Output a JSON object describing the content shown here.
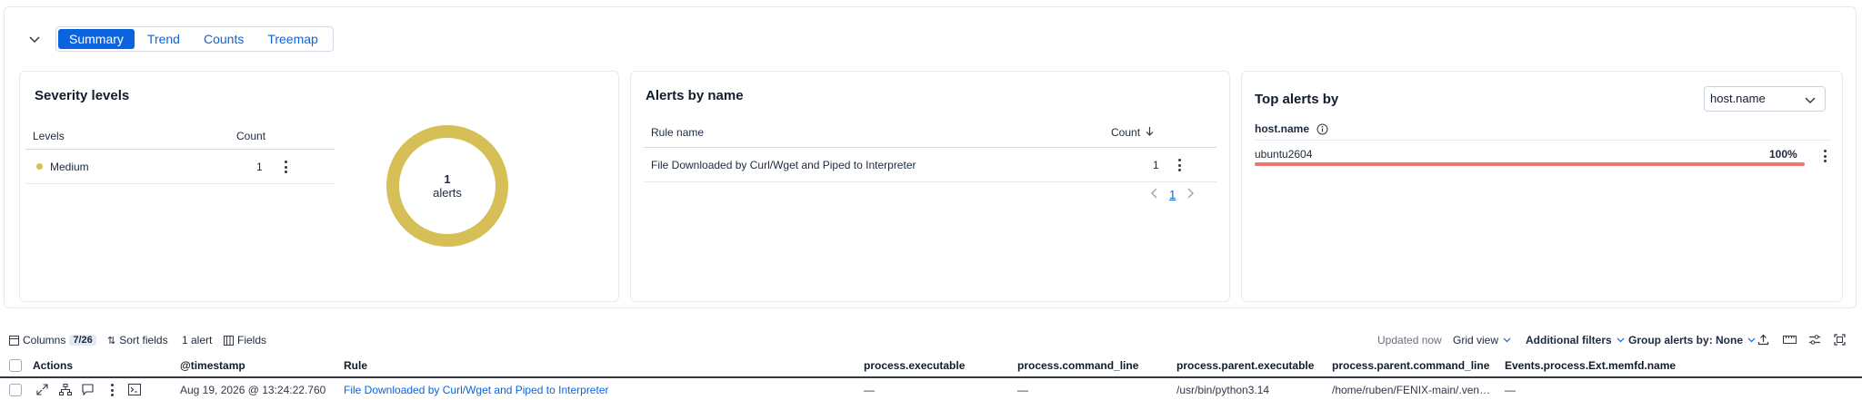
{
  "tabs": [
    "Summary",
    "Trend",
    "Counts",
    "Treemap"
  ],
  "severity": {
    "title": "Severity levels",
    "col_levels": "Levels",
    "col_count": "Count",
    "rows": [
      {
        "level": "Medium",
        "count": "1",
        "color": "#d6bf57"
      }
    ],
    "donut_count": "1",
    "donut_unit": "alerts",
    "donut_color": "#d6bf57"
  },
  "alerts_by_name": {
    "title": "Alerts by name",
    "col_rule": "Rule name",
    "col_count": "Count",
    "rows": [
      {
        "name": "File Downloaded by Curl/Wget and Piped to Interpreter",
        "count": "1"
      }
    ],
    "page": "1"
  },
  "top_alerts": {
    "title": "Top alerts by",
    "select_value": "host.name",
    "field_label": "host.name",
    "rows": [
      {
        "name": "ubuntu2604",
        "percent_label": "100%",
        "fraction": 1.0,
        "color": "#f0766d"
      }
    ]
  },
  "toolbar": {
    "columns_label": "Columns",
    "columns_badge": "7/26",
    "sort_label": "Sort fields",
    "alert_count": "1 alert",
    "fields_label": "Fields",
    "updated": "Updated now",
    "grid_view": "Grid view",
    "additional_filters": "Additional filters",
    "group_alerts": "Group alerts by: None"
  },
  "grid": {
    "headers": [
      "Actions",
      "@timestamp",
      "Rule",
      "process.executable",
      "process.command_line",
      "process.parent.executable",
      "process.parent.command_line",
      "Events.process.Ext.memfd.name"
    ],
    "row": {
      "timestamp": "Aug 19, 2026 @ 13:24:22.760",
      "rule": "File Downloaded by Curl/Wget and Piped to Interpreter",
      "executable": "—",
      "command_line": "—",
      "parent_executable": "/usr/bin/python3.14",
      "parent_command_line": "/home/ruben/FENIX-main/.venv/b...",
      "memfd_name": "—"
    }
  },
  "colors": {
    "accent": "#0b64dd",
    "text": "#1d2a3e"
  }
}
